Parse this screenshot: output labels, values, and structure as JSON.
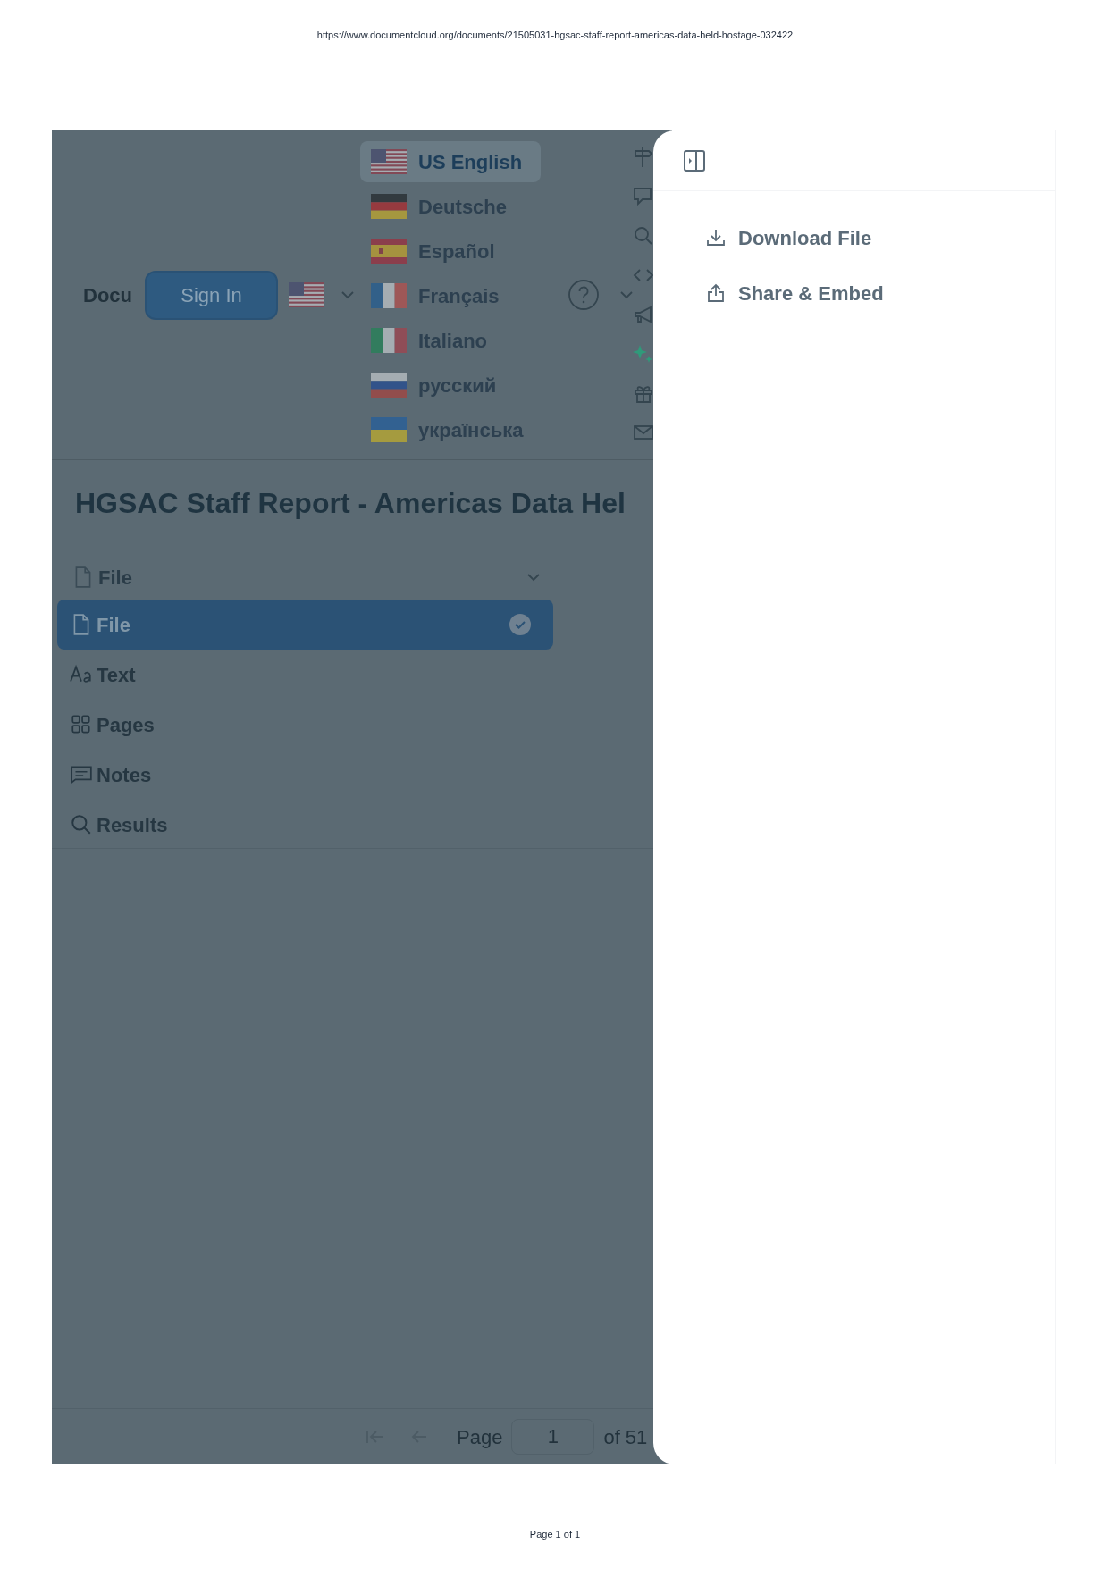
{
  "url": "https://www.documentcloud.org/documents/21505031-hgsac-staff-report-americas-data-held-hostage-032422",
  "header": {
    "brand": "Docu",
    "sign_in": "Sign In",
    "kind": "us"
  },
  "languages": [
    {
      "label": "US English",
      "kind": "us",
      "selected": true
    },
    {
      "label": "Deutsche",
      "kind": "de",
      "selected": false
    },
    {
      "label": "Español",
      "kind": "es",
      "selected": false
    },
    {
      "label": "Français",
      "kind": "fr",
      "selected": false
    },
    {
      "label": "Italiano",
      "kind": "it",
      "selected": false
    },
    {
      "label": "русский",
      "kind": "ru",
      "selected": false
    },
    {
      "label": "українська",
      "kind": "ua",
      "selected": false
    }
  ],
  "document": {
    "title": "HGSAC Staff Report - Americas Data Hel",
    "view_menu": {
      "label": "File",
      "items": [
        {
          "label": "File",
          "kind": "file",
          "selected": true
        },
        {
          "label": "Text",
          "kind": "text",
          "selected": false
        },
        {
          "label": "Pages",
          "kind": "grid",
          "selected": false
        },
        {
          "label": "Notes",
          "kind": "note",
          "selected": false
        },
        {
          "label": "Results",
          "kind": "search",
          "selected": false
        }
      ]
    }
  },
  "pagination": {
    "label": "Page",
    "value": "1",
    "total": "of 51"
  },
  "side_panel": {
    "actions": [
      {
        "label": "Download File",
        "kind": "download"
      },
      {
        "label": "Share & Embed",
        "kind": "share"
      }
    ]
  },
  "footer": "Page 1 of 1"
}
